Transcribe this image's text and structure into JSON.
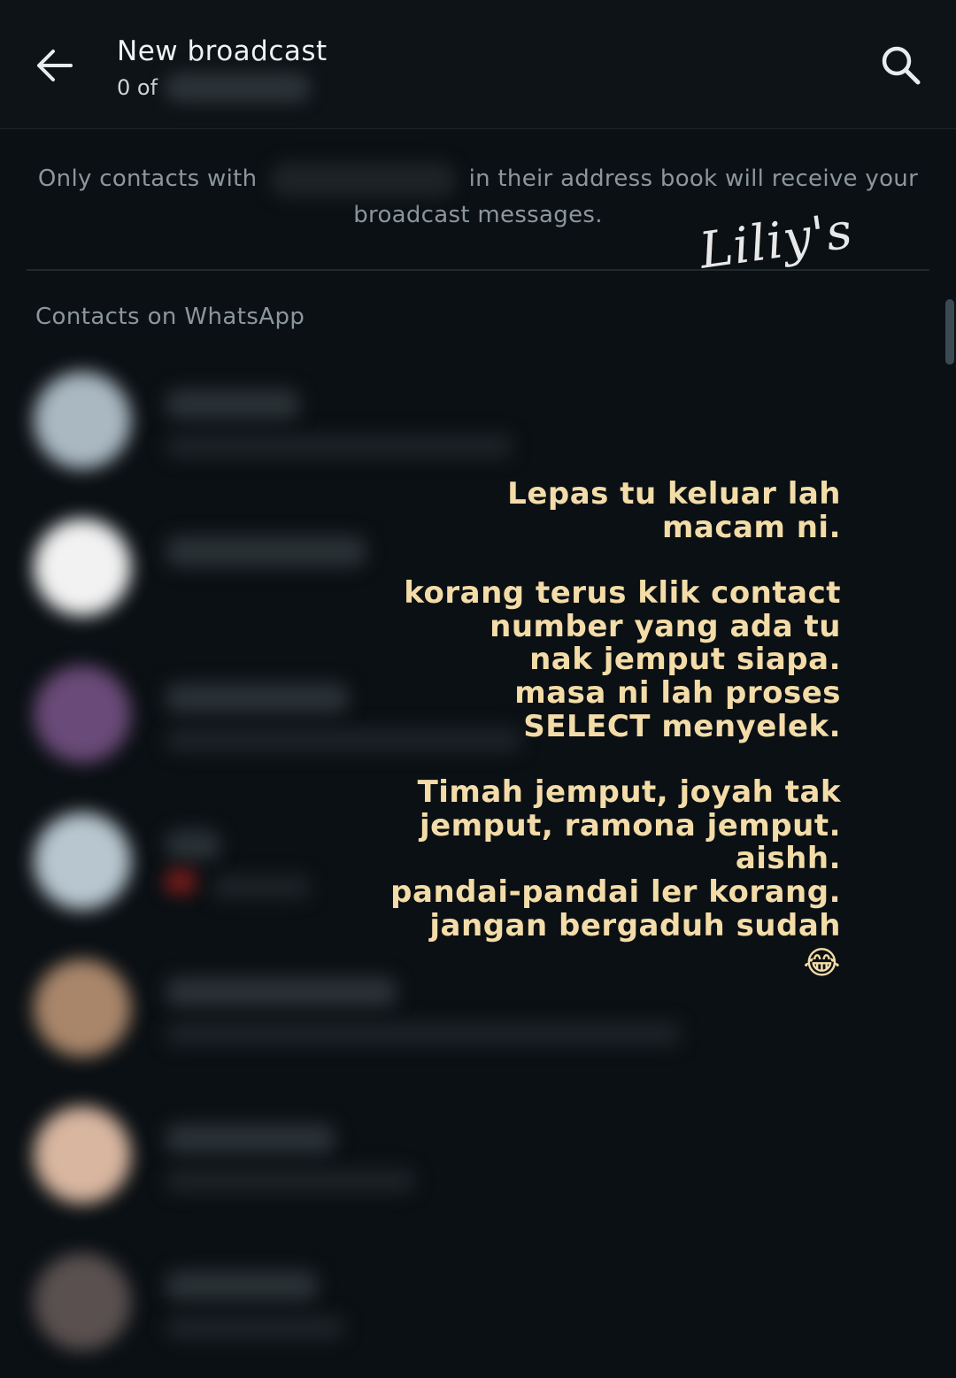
{
  "header": {
    "title": "New broadcast",
    "subtitle": "0 of"
  },
  "notice": {
    "before": "Only contacts with",
    "after": "in their address book will receive your broadcast messages."
  },
  "watermark": "Liliy's",
  "section": {
    "label": "Contacts on WhatsApp"
  },
  "contacts": [
    {
      "avatar_color": "#aab8c2"
    },
    {
      "avatar_color": "#f2f2f2"
    },
    {
      "avatar_color": "#6a4a78"
    },
    {
      "avatar_color": "#b8c6cf"
    },
    {
      "avatar_color": "#a9866a"
    },
    {
      "avatar_color": "#d8b6a0"
    },
    {
      "avatar_color": "#5a5050"
    }
  ],
  "overlay": {
    "paragraphs": [
      [
        "Lepas tu keluar lah",
        "macam ni."
      ],
      [
        "korang terus klik contact",
        "number yang ada tu",
        "nak jemput siapa.",
        "masa ni lah proses",
        "SELECT menyelek."
      ],
      [
        "Timah jemput, joyah tak",
        "jemput, ramona jemput.",
        "aishh.",
        "pandai-pandai ler korang.",
        "jangan bergaduh sudah"
      ]
    ],
    "emoji": "😂"
  },
  "colors": {
    "background": "#0b1014",
    "overlay_text": "#f3dca8",
    "secondary_text": "#8b979d"
  }
}
